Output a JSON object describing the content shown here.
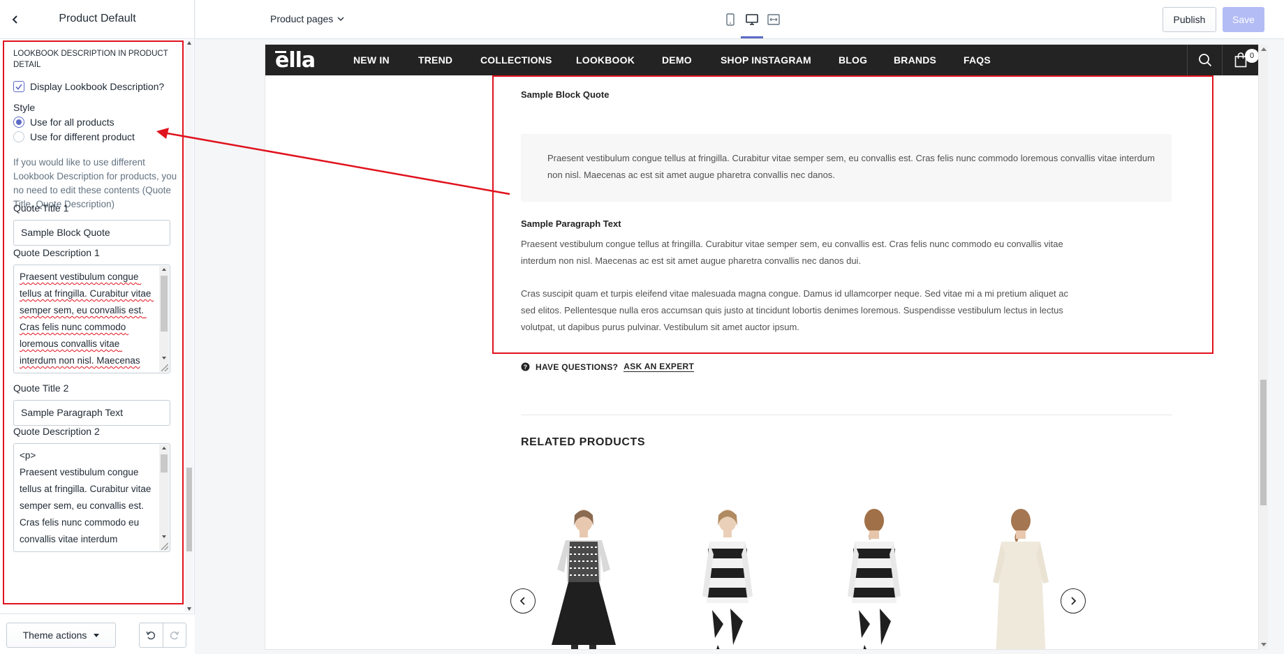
{
  "sidebar": {
    "title": "Product Default",
    "section_heading": "LOOKBOOK DESCRIPTION IN PRODUCT DETAIL",
    "display_checkbox_label": "Display Lookbook Description?",
    "style_label": "Style",
    "radio_all": "Use for all products",
    "radio_different": "Use for different product",
    "help_text": "If you would like to use different Lookbook Description for products, you no need to edit these contents (Quote Title, Quote Description)",
    "quote_title_1_label": "Quote Title 1",
    "quote_title_1_value": "Sample Block Quote",
    "quote_desc_1_label": "Quote Description 1",
    "quote_desc_1_value": "Praesent vestibulum congue tellus at fringilla. Curabitur vitae semper sem, eu convallis est. Cras felis nunc commodo loremous convallis vitae interdum non nisl. Maecenas",
    "quote_title_2_label": "Quote Title 2",
    "quote_title_2_value": "Sample Paragraph Text",
    "quote_desc_2_label": "Quote Description 2",
    "quote_desc_2_value": "<p>\nPraesent vestibulum congue tellus at fringilla. Curabitur vitae semper sem, eu convallis est. Cras felis nunc commodo eu convallis vitae interdum",
    "theme_actions": "Theme actions"
  },
  "topbar": {
    "page_select": "Product pages",
    "publish": "Publish",
    "save": "Save"
  },
  "site": {
    "logo": "ella",
    "nav": [
      "NEW IN",
      "TREND",
      "COLLECTIONS",
      "LOOKBOOK",
      "DEMO",
      "SHOP INSTAGRAM",
      "BLOG",
      "BRANDS",
      "FAQS"
    ],
    "cart_count": "0"
  },
  "preview": {
    "quote_title": "Sample Block Quote",
    "quote_text": "Praesent vestibulum congue tellus at fringilla. Curabitur vitae semper sem, eu convallis est. Cras felis nunc commodo loremous convallis vitae interdum non nisl. Maecenas ac est sit amet augue pharetra convallis nec danos.",
    "paragraph_title": "Sample Paragraph Text",
    "paragraph_1": "Praesent vestibulum congue tellus at fringilla. Curabitur vitae semper sem, eu convallis est. Cras felis nunc commodo eu convallis vitae interdum non nisl. Maecenas ac est sit amet augue pharetra convallis nec danos dui.",
    "paragraph_2": "Cras suscipit quam et turpis eleifend vitae malesuada magna congue. Damus id ullamcorper neque. Sed vitae mi a mi pretium aliquet ac sed elitos. Pellentesque nulla eros accumsan quis justo at tincidunt lobortis denimes loremous. Suspendisse vestibulum lectus in lectus volutpat, ut dapibus purus pulvinar. Vestibulum sit amet auctor ipsum.",
    "have_questions": "HAVE QUESTIONS?",
    "ask_expert": "ASK AN EXPERT",
    "related_title": "RELATED PRODUCTS"
  },
  "colors": {
    "accent": "#5c6ac4",
    "annotation_red": "#e0121d",
    "nav_bg": "#232323"
  }
}
